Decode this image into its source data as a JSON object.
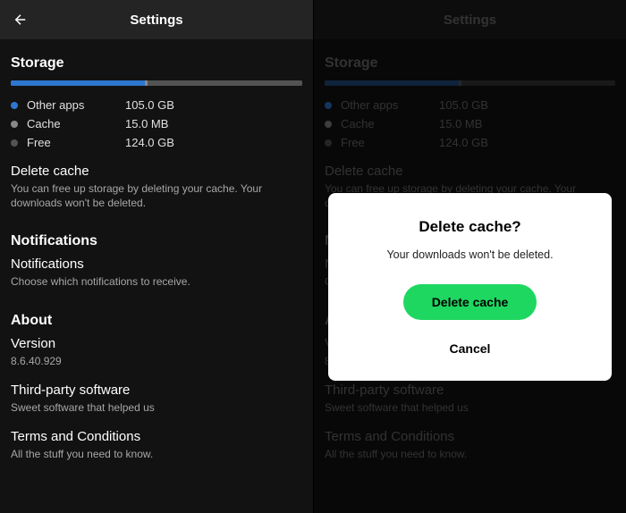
{
  "header": {
    "title": "Settings"
  },
  "storage": {
    "heading": "Storage",
    "bar": {
      "apps_pct": 46,
      "cache_pct": 1,
      "free_pct": 53
    },
    "legend": [
      {
        "label": "Other apps",
        "value": "105.0 GB"
      },
      {
        "label": "Cache",
        "value": "15.0 MB"
      },
      {
        "label": "Free",
        "value": "124.0 GB"
      }
    ],
    "delete_cache": {
      "title": "Delete cache",
      "subtitle": "You can free up storage by deleting your cache. Your downloads won't be deleted."
    }
  },
  "notifications": {
    "heading": "Notifications",
    "item": {
      "title": "Notifications",
      "subtitle": "Choose which notifications to receive."
    }
  },
  "about": {
    "heading": "About",
    "version": {
      "title": "Version",
      "subtitle": "8.6.40.929"
    },
    "thirdparty": {
      "title": "Third-party software",
      "subtitle": "Sweet software that helped us"
    },
    "terms": {
      "title": "Terms and Conditions",
      "subtitle": "All the stuff you need to know."
    }
  },
  "modal": {
    "title": "Delete cache?",
    "message": "Your downloads won't be deleted.",
    "confirm": "Delete cache",
    "cancel": "Cancel"
  }
}
